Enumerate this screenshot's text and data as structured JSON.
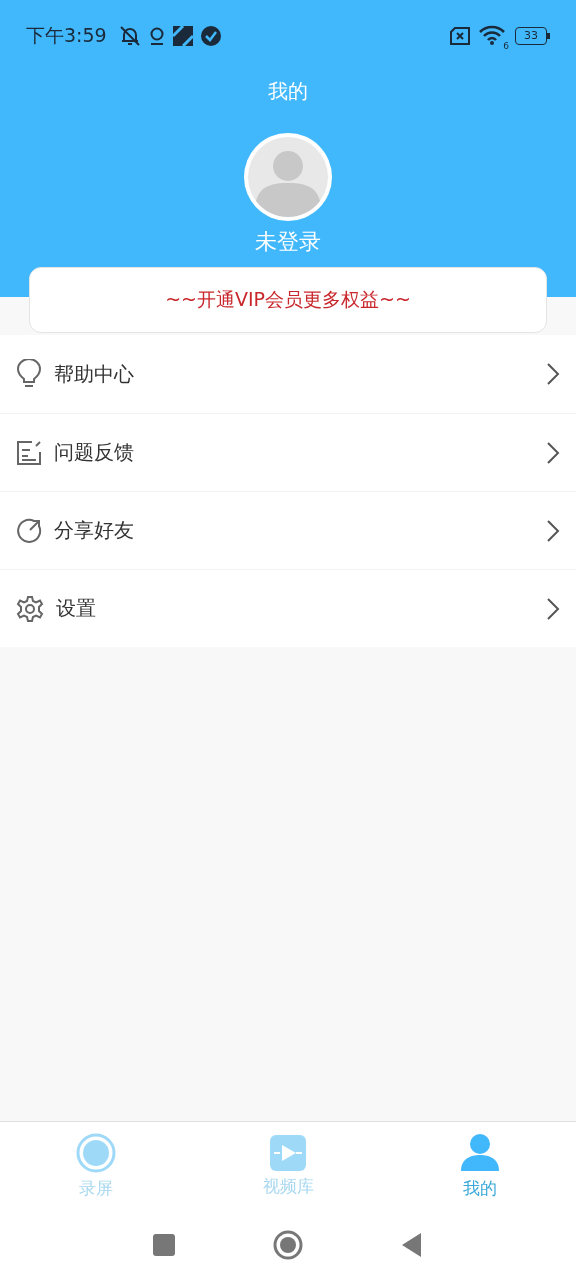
{
  "status_bar": {
    "time": "下午3:59",
    "wifi_label": "6",
    "battery": "33"
  },
  "header": {
    "title": "我的",
    "login_status": "未登录"
  },
  "vip_banner": "~~开通VIP会员更多权益~~",
  "menu": [
    {
      "kind": "help",
      "label": "帮助中心"
    },
    {
      "kind": "feedback",
      "label": "问题反馈"
    },
    {
      "kind": "share",
      "label": "分享好友"
    },
    {
      "kind": "settings",
      "label": "设置"
    }
  ],
  "tabs": [
    {
      "kind": "record",
      "label": "录屏",
      "selected": false
    },
    {
      "kind": "library",
      "label": "视频库",
      "selected": false
    },
    {
      "kind": "me",
      "label": "我的",
      "selected": true
    }
  ]
}
